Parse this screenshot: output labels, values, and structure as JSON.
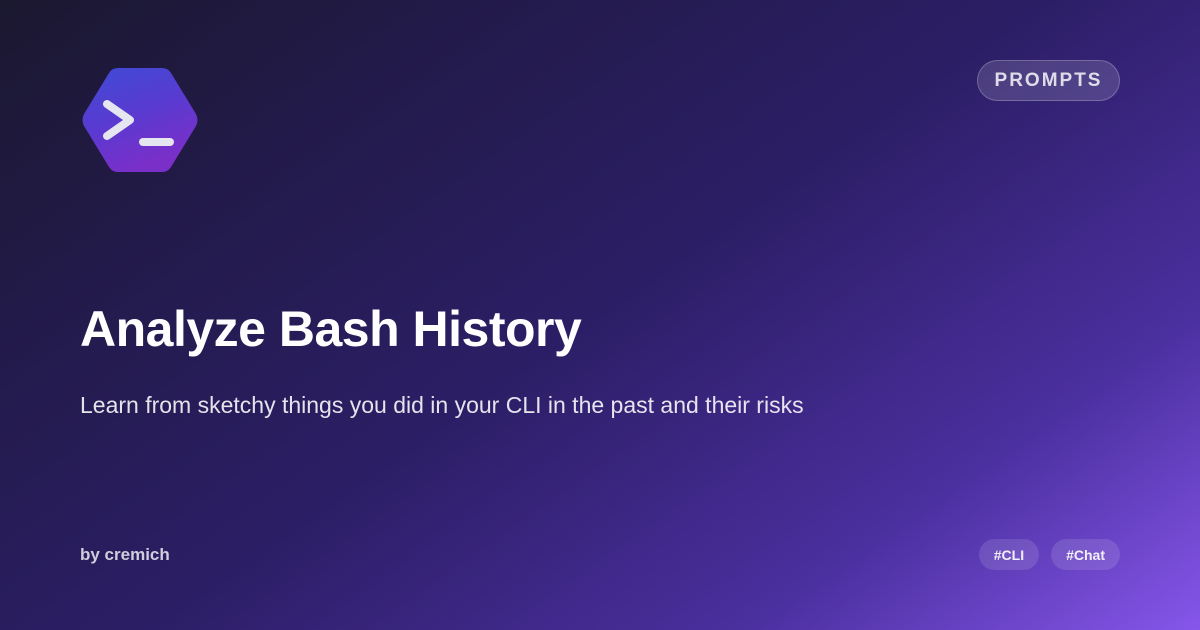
{
  "badge": {
    "label": "PROMPTS"
  },
  "logo": {
    "icon": "terminal-prompt-icon",
    "colors": {
      "top": "#3f4bd6",
      "bottom": "#7a2fc9",
      "glyph": "#e6e6f0"
    }
  },
  "title": "Analyze Bash History",
  "subtitle": "Learn from sketchy things you did in your CLI in the past and their risks",
  "author": "by cremich",
  "tags": [
    {
      "label": "#CLI"
    },
    {
      "label": "#Chat"
    }
  ],
  "colors": {
    "background_start": "#1b1830",
    "background_end": "#8656ea",
    "text": "#ffffff"
  }
}
